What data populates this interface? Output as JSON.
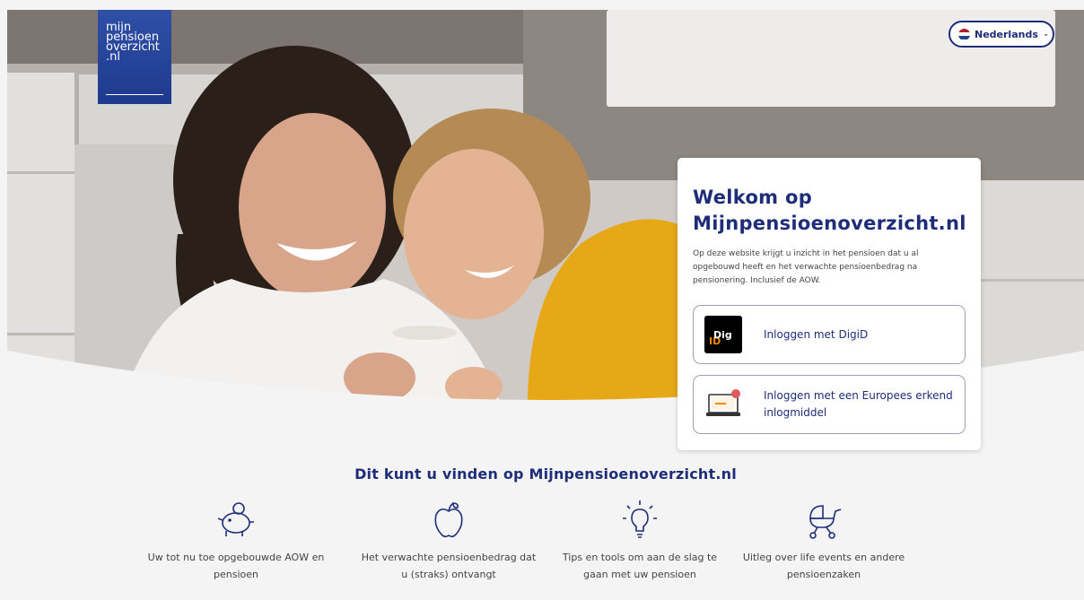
{
  "brand": {
    "logo_text": "mijn\npensioen\noverzicht\n.nl"
  },
  "language": {
    "label": "Nederlands"
  },
  "hero": {
    "image": "hero-photo"
  },
  "welcome": {
    "title_line1": "Welkom op",
    "title_line2": "Mijnpensioenoverzicht.nl",
    "intro": "Op deze website krijgt u inzicht in het pensioen dat u al opgebouwd heeft en het verwachte pensioenbedrag na pensionering. Inclusief de AOW.",
    "login_digid": "Inloggen met DigiD",
    "digid_logo_prefix": "Dig",
    "digid_logo_suffix": "ID",
    "login_eu": "Inloggen met een Europees erkend inlogmiddel"
  },
  "features": {
    "title": "Dit kunt u vinden op Mijnpensioenoverzicht.nl",
    "items": [
      {
        "icon": "piggy-bank-icon",
        "text": "Uw tot nu toe opgebouwde AOW en pensioen"
      },
      {
        "icon": "apple-icon",
        "text": "Het verwachte pensioenbedrag dat u (straks) ontvangt"
      },
      {
        "icon": "lightbulb-icon",
        "text": "Tips en tools om aan de slag te gaan met uw pensioen"
      },
      {
        "icon": "stroller-icon",
        "text": "Uitleg over life events en andere pensioenzaken"
      }
    ]
  },
  "colors": {
    "primary": "#1e2d7a",
    "logo_bg": "#2a4a9e",
    "digid_orange": "#f18a00",
    "sweater_yellow": "#e6a817"
  }
}
